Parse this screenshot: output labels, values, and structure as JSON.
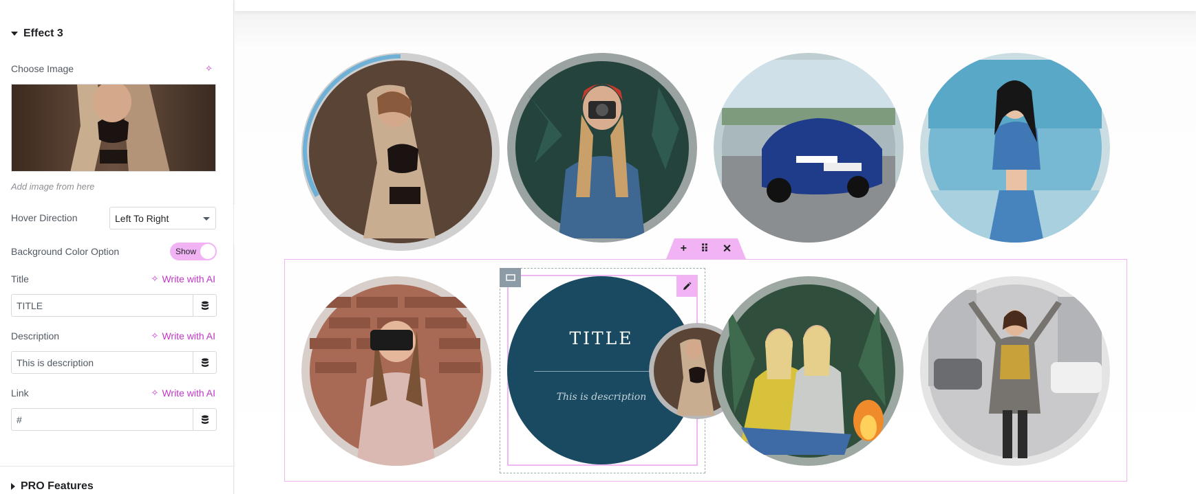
{
  "panel": {
    "section_title": "Effect 3",
    "choose_image_label": "Choose Image",
    "image_hint": "Add image from here",
    "hover_direction_label": "Hover Direction",
    "hover_direction_value": "Left To Right",
    "bg_color_option_label": "Background Color Option",
    "bg_color_toggle_text": "Show",
    "title_label": "Title",
    "title_value": "TITLE",
    "description_label": "Description",
    "description_value": "This is description",
    "link_label": "Link",
    "link_value": "#",
    "write_ai": "Write with AI",
    "pro_features": "PRO Features"
  },
  "canvas": {
    "hover_title": "TITLE",
    "hover_description": "This is description",
    "section_tools": [
      "+",
      "⠿",
      "✕"
    ]
  },
  "colors": {
    "accent": "#c036c6",
    "accent_light": "#f2b3f4",
    "hover_bg": "#1a4a61"
  }
}
